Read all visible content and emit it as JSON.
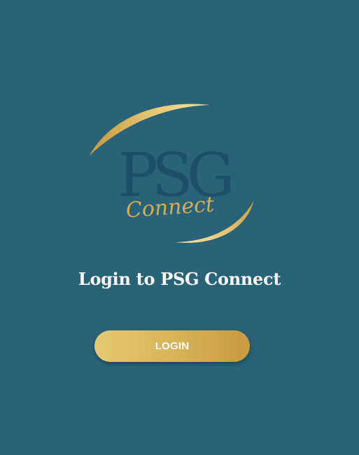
{
  "logo": {
    "letters": "PSG",
    "script": "Connect",
    "icon": "psg-connect-logo",
    "colors": {
      "letters": "#1d4f68",
      "gold_light": "#f2dc95",
      "gold_dark": "#c49a3e"
    }
  },
  "heading": "Login to PSG Connect",
  "login_button": {
    "label": "LOGIN",
    "colors": {
      "from": "#e6c873",
      "to": "#c79b3f"
    }
  },
  "colors": {
    "background": "#2a6278",
    "text": "#ffffff"
  }
}
